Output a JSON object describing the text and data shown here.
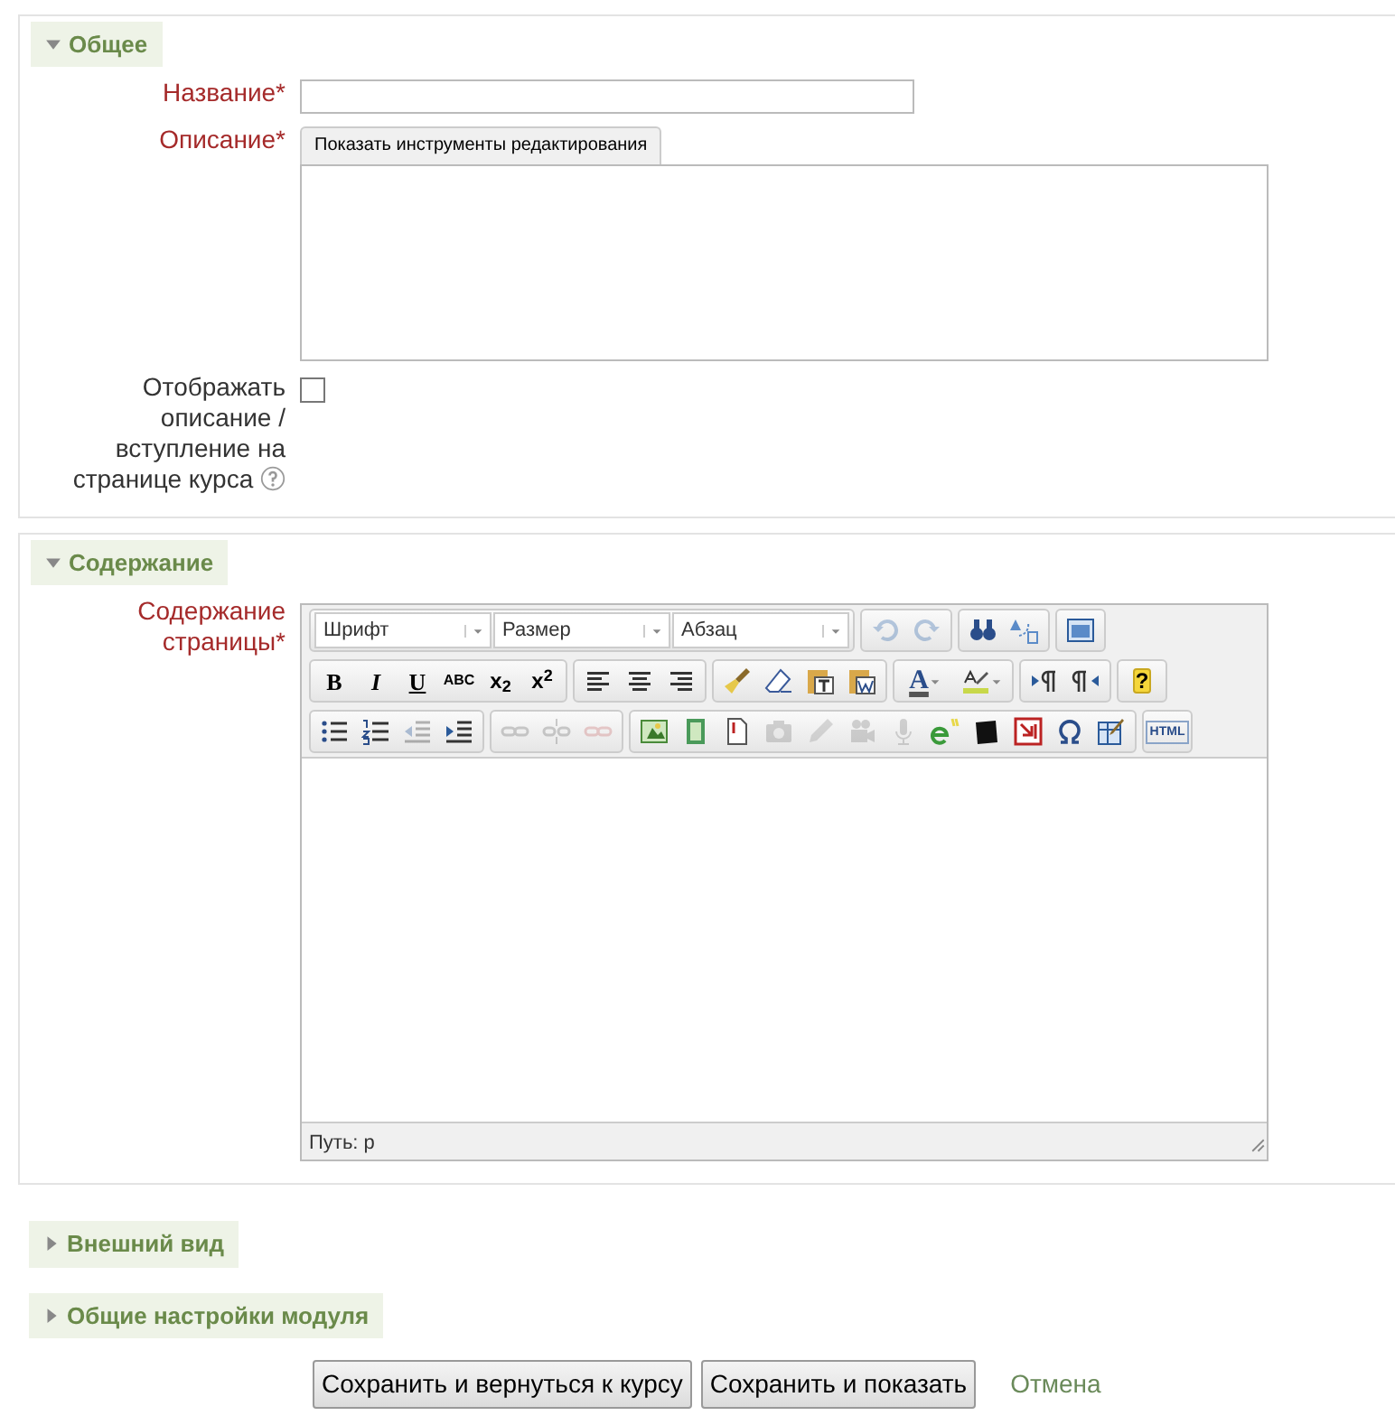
{
  "sections": [
    {
      "legend": "Общее",
      "expanded": true,
      "fields": [
        {
          "kind": "text",
          "label": "Название",
          "required_mark": "*"
        },
        {
          "kind": "editor-collapsed",
          "label": "Описание",
          "required_mark": "*",
          "toggle": "Показать инструменты редактирования"
        },
        {
          "kind": "checkbox",
          "label": "Отображать описание / вступление на странице курса",
          "checked": false,
          "help": true
        }
      ]
    },
    {
      "legend": "Содержание",
      "expanded": true,
      "fields": [
        {
          "kind": "editor",
          "label": "Содержание страницы",
          "required_mark": "*",
          "path": "Путь: p",
          "toolbar": [
            [
              [
                {
                  "kind": "select",
                  "label": "Шрифт"
                },
                {
                  "kind": "select",
                  "label": "Размер"
                },
                {
                  "kind": "select",
                  "label": "Абзац"
                }
              ],
              [
                {
                  "kind": "undo",
                  "disabled": true
                },
                {
                  "kind": "redo",
                  "disabled": true
                }
              ],
              [
                {
                  "kind": "find",
                  "disabled": false
                },
                {
                  "kind": "replace",
                  "disabled": false
                }
              ],
              [
                {
                  "kind": "fullscreen",
                  "disabled": false
                }
              ]
            ],
            [
              [
                {
                  "kind": "bold",
                  "label": "B"
                },
                {
                  "kind": "italic",
                  "label": "I"
                },
                {
                  "kind": "underline",
                  "label": "U"
                },
                {
                  "kind": "strike",
                  "label": "ABC"
                },
                {
                  "kind": "sub",
                  "label": "x$_{2}$"
                },
                {
                  "kind": "sup",
                  "label": "x$^{2}$"
                }
              ],
              [
                {
                  "kind": "align-left",
                  "disabled": false
                },
                {
                  "kind": "align-center",
                  "disabled": false
                },
                {
                  "kind": "align-right",
                  "disabled": false
                }
              ],
              [
                {
                  "kind": "brush",
                  "disabled": false
                },
                {
                  "kind": "eraser",
                  "disabled": false
                },
                {
                  "kind": "paste-text",
                  "disabled": false
                },
                {
                  "kind": "paste-word",
                  "disabled": false
                }
              ],
              [
                {
                  "kind": "color-text",
                  "label": "A"
                },
                {
                  "kind": "highlight",
                  "disabled": false
                }
              ],
              [
                {
                  "kind": "ltr",
                  "disabled": false
                },
                {
                  "kind": "rtl",
                  "disabled": false
                }
              ],
              [
                {
                  "kind": "help",
                  "label": "?"
                }
              ]
            ],
            [
              [
                {
                  "kind": "bullets",
                  "disabled": false
                },
                {
                  "kind": "numbers",
                  "disabled": false
                },
                {
                  "kind": "outdent",
                  "disabled": true
                },
                {
                  "kind": "indent",
                  "disabled": false
                }
              ],
              [
                {
                  "kind": "link",
                  "disabled": true
                },
                {
                  "kind": "unlink",
                  "disabled": true
                },
                {
                  "kind": "anchor",
                  "disabled": true
                }
              ],
              [
                {
                  "kind": "image",
                  "disabled": false
                },
                {
                  "kind": "media",
                  "disabled": false
                },
                {
                  "kind": "file",
                  "disabled": false
                },
                {
                  "kind": "camera",
                  "disabled": true
                },
                {
                  "kind": "pencil",
                  "disabled": true
                },
                {
                  "kind": "video",
                  "disabled": true
                },
                {
                  "kind": "mic",
                  "disabled": true
                },
                {
                  "kind": "equation",
                  "disabled": false
                },
                {
                  "kind": "square",
                  "disabled": false
                },
                {
                  "kind": "nolink",
                  "disabled": false
                },
                {
                  "kind": "omega",
                  "disabled": false
                },
                {
                  "kind": "table",
                  "disabled": false
                }
              ],
              [
                {
                  "kind": "html",
                  "label": "HTML"
                }
              ]
            ]
          ]
        }
      ]
    },
    {
      "legend": "Внешний вид",
      "expanded": false
    },
    {
      "legend": "Общие настройки модуля",
      "expanded": false
    }
  ],
  "buttons": [
    {
      "kind": "button",
      "label": "Сохранить и вернуться к курсу"
    },
    {
      "kind": "button",
      "label": "Сохранить и показать"
    },
    {
      "kind": "link",
      "label": "Отмена"
    }
  ]
}
